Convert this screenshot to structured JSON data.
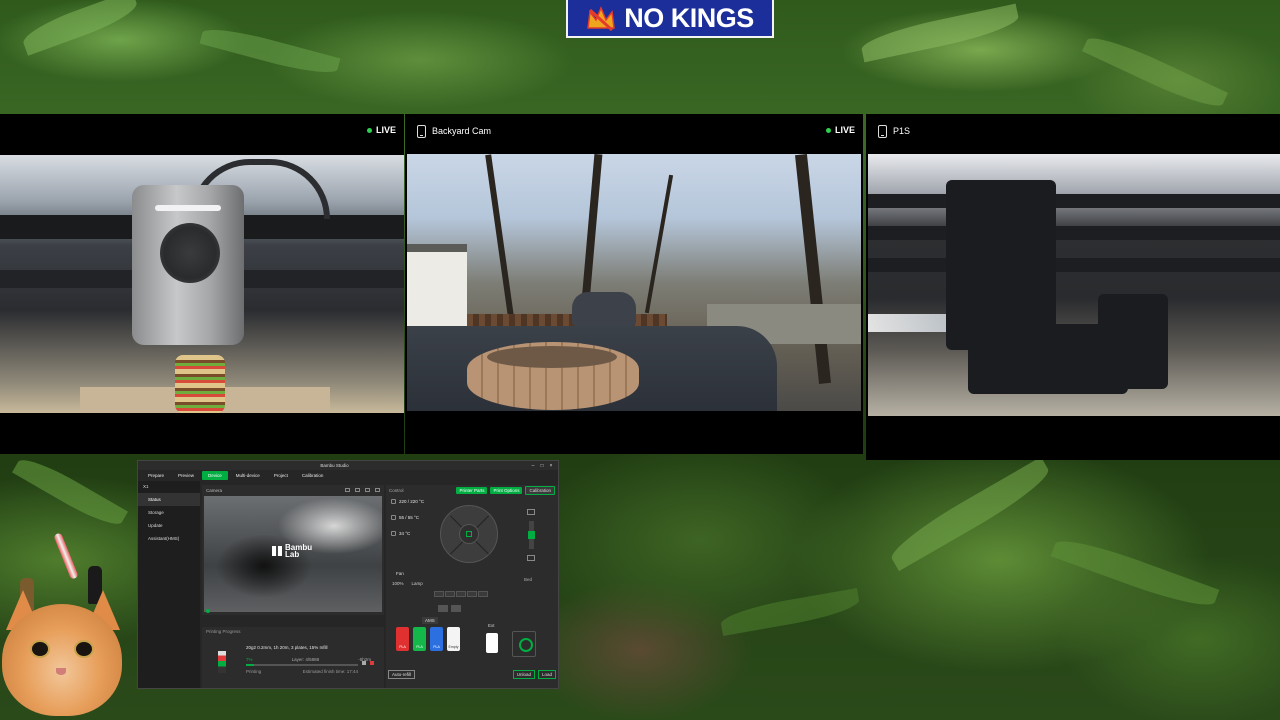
{
  "banner": {
    "text": "NO KINGS"
  },
  "cameras": [
    {
      "name": "",
      "live": "LIVE"
    },
    {
      "name": "Backyard Cam",
      "live": "LIVE"
    },
    {
      "name": "P1S",
      "live": ""
    }
  ],
  "app": {
    "title": "Bambu Studio",
    "tabs": [
      "Prepare",
      "Preview",
      "Device",
      "Multi-device",
      "Project",
      "Calibration"
    ],
    "active_tab": "Device",
    "device_name": "X1",
    "sidebar": [
      "Status",
      "Storage",
      "Update",
      "Assistant(HMS)"
    ],
    "camera_label": "Camera",
    "logo_text_line1": "Bambu",
    "logo_text_line2": "Lab",
    "printing": {
      "header": "Printing Progress",
      "file": "20g2 0.2mm, 1h 20m, 3 plates, 15% Infill",
      "percent": "7%",
      "layer": "Layer: 4/5888",
      "time": "-5h2m",
      "status": "Printing",
      "estimate": "Estimated finish time: 17:44",
      "progress": 0.07
    },
    "control": {
      "header": "Control",
      "printer_parts": "Printer Parts",
      "print_options": "Print Options",
      "calibration": "Calibration",
      "nozzle_temp": "220 / 220 °C",
      "bed_temp": "55 / 55 °C",
      "chamber_temp": "34 °C",
      "fan_label": "Fan",
      "fan_values": [
        "100%",
        "Lamp"
      ],
      "bed_label": "Bed",
      "ams_label": "AMS",
      "ext_label": "Ext",
      "slots": [
        {
          "label": "PLA",
          "color": "#e03030"
        },
        {
          "label": "PLA",
          "color": "#14b84a"
        },
        {
          "label": "PLA",
          "color": "#2b6fe0"
        },
        {
          "label": "Empty",
          "color": "#f4f4f4"
        }
      ],
      "foot_left": "Auto-refill",
      "unload": "Unload",
      "load": "Load"
    }
  }
}
